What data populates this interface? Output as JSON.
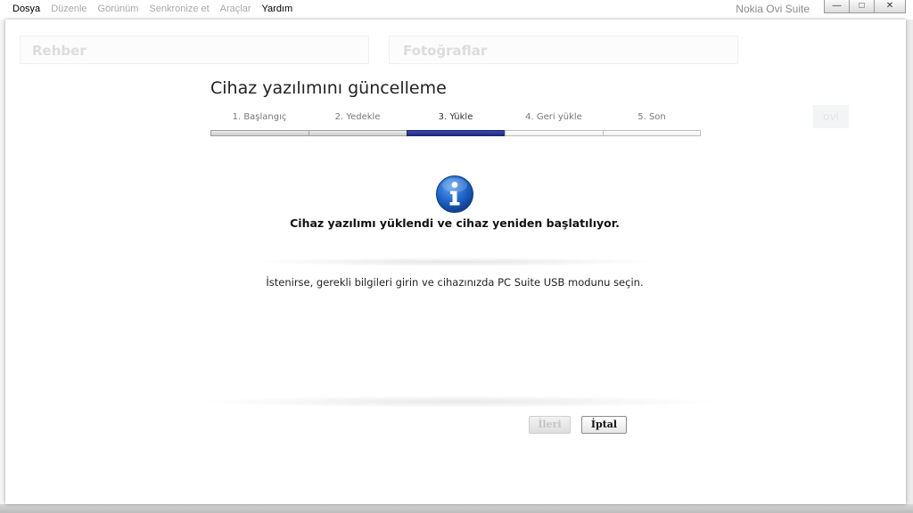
{
  "menu": {
    "items": [
      {
        "label": "Dosya",
        "enabled": true
      },
      {
        "label": "Düzenle",
        "enabled": false
      },
      {
        "label": "Görünüm",
        "enabled": false
      },
      {
        "label": "Senkronize et",
        "enabled": false
      },
      {
        "label": "Araçlar",
        "enabled": false
      },
      {
        "label": "Yardım",
        "enabled": true
      }
    ]
  },
  "window": {
    "title": "Nokia Ovi Suite",
    "buttons": {
      "minimize": "minimize-icon",
      "maximize": "maximize-icon",
      "close": "close-icon"
    }
  },
  "background": {
    "panel_left": "Rehber",
    "panel_right": "Fotoğraflar",
    "badge": "ovi"
  },
  "dialog": {
    "title": "Cihaz yazılımını güncelleme",
    "steps": [
      {
        "label": "1. Başlangıç",
        "state": "done"
      },
      {
        "label": "2. Yedekle",
        "state": "done"
      },
      {
        "label": "3. Yükle",
        "state": "active"
      },
      {
        "label": "4. Geri yükle",
        "state": "todo"
      },
      {
        "label": "5. Son",
        "state": "todo"
      }
    ],
    "icon": "info-icon",
    "message": "Cihaz yazılımı yüklendi ve cihaz yeniden başlatılıyor.",
    "hint": "İstenirse, gerekli bilgileri girin ve cihazınızda PC Suite USB modunu seçin.",
    "buttons": {
      "next": {
        "label": "İleri",
        "enabled": false
      },
      "cancel": {
        "label": "İptal",
        "enabled": true
      }
    }
  },
  "colors": {
    "active_step": "#1e2a85",
    "info_icon": "#1f63c6"
  }
}
